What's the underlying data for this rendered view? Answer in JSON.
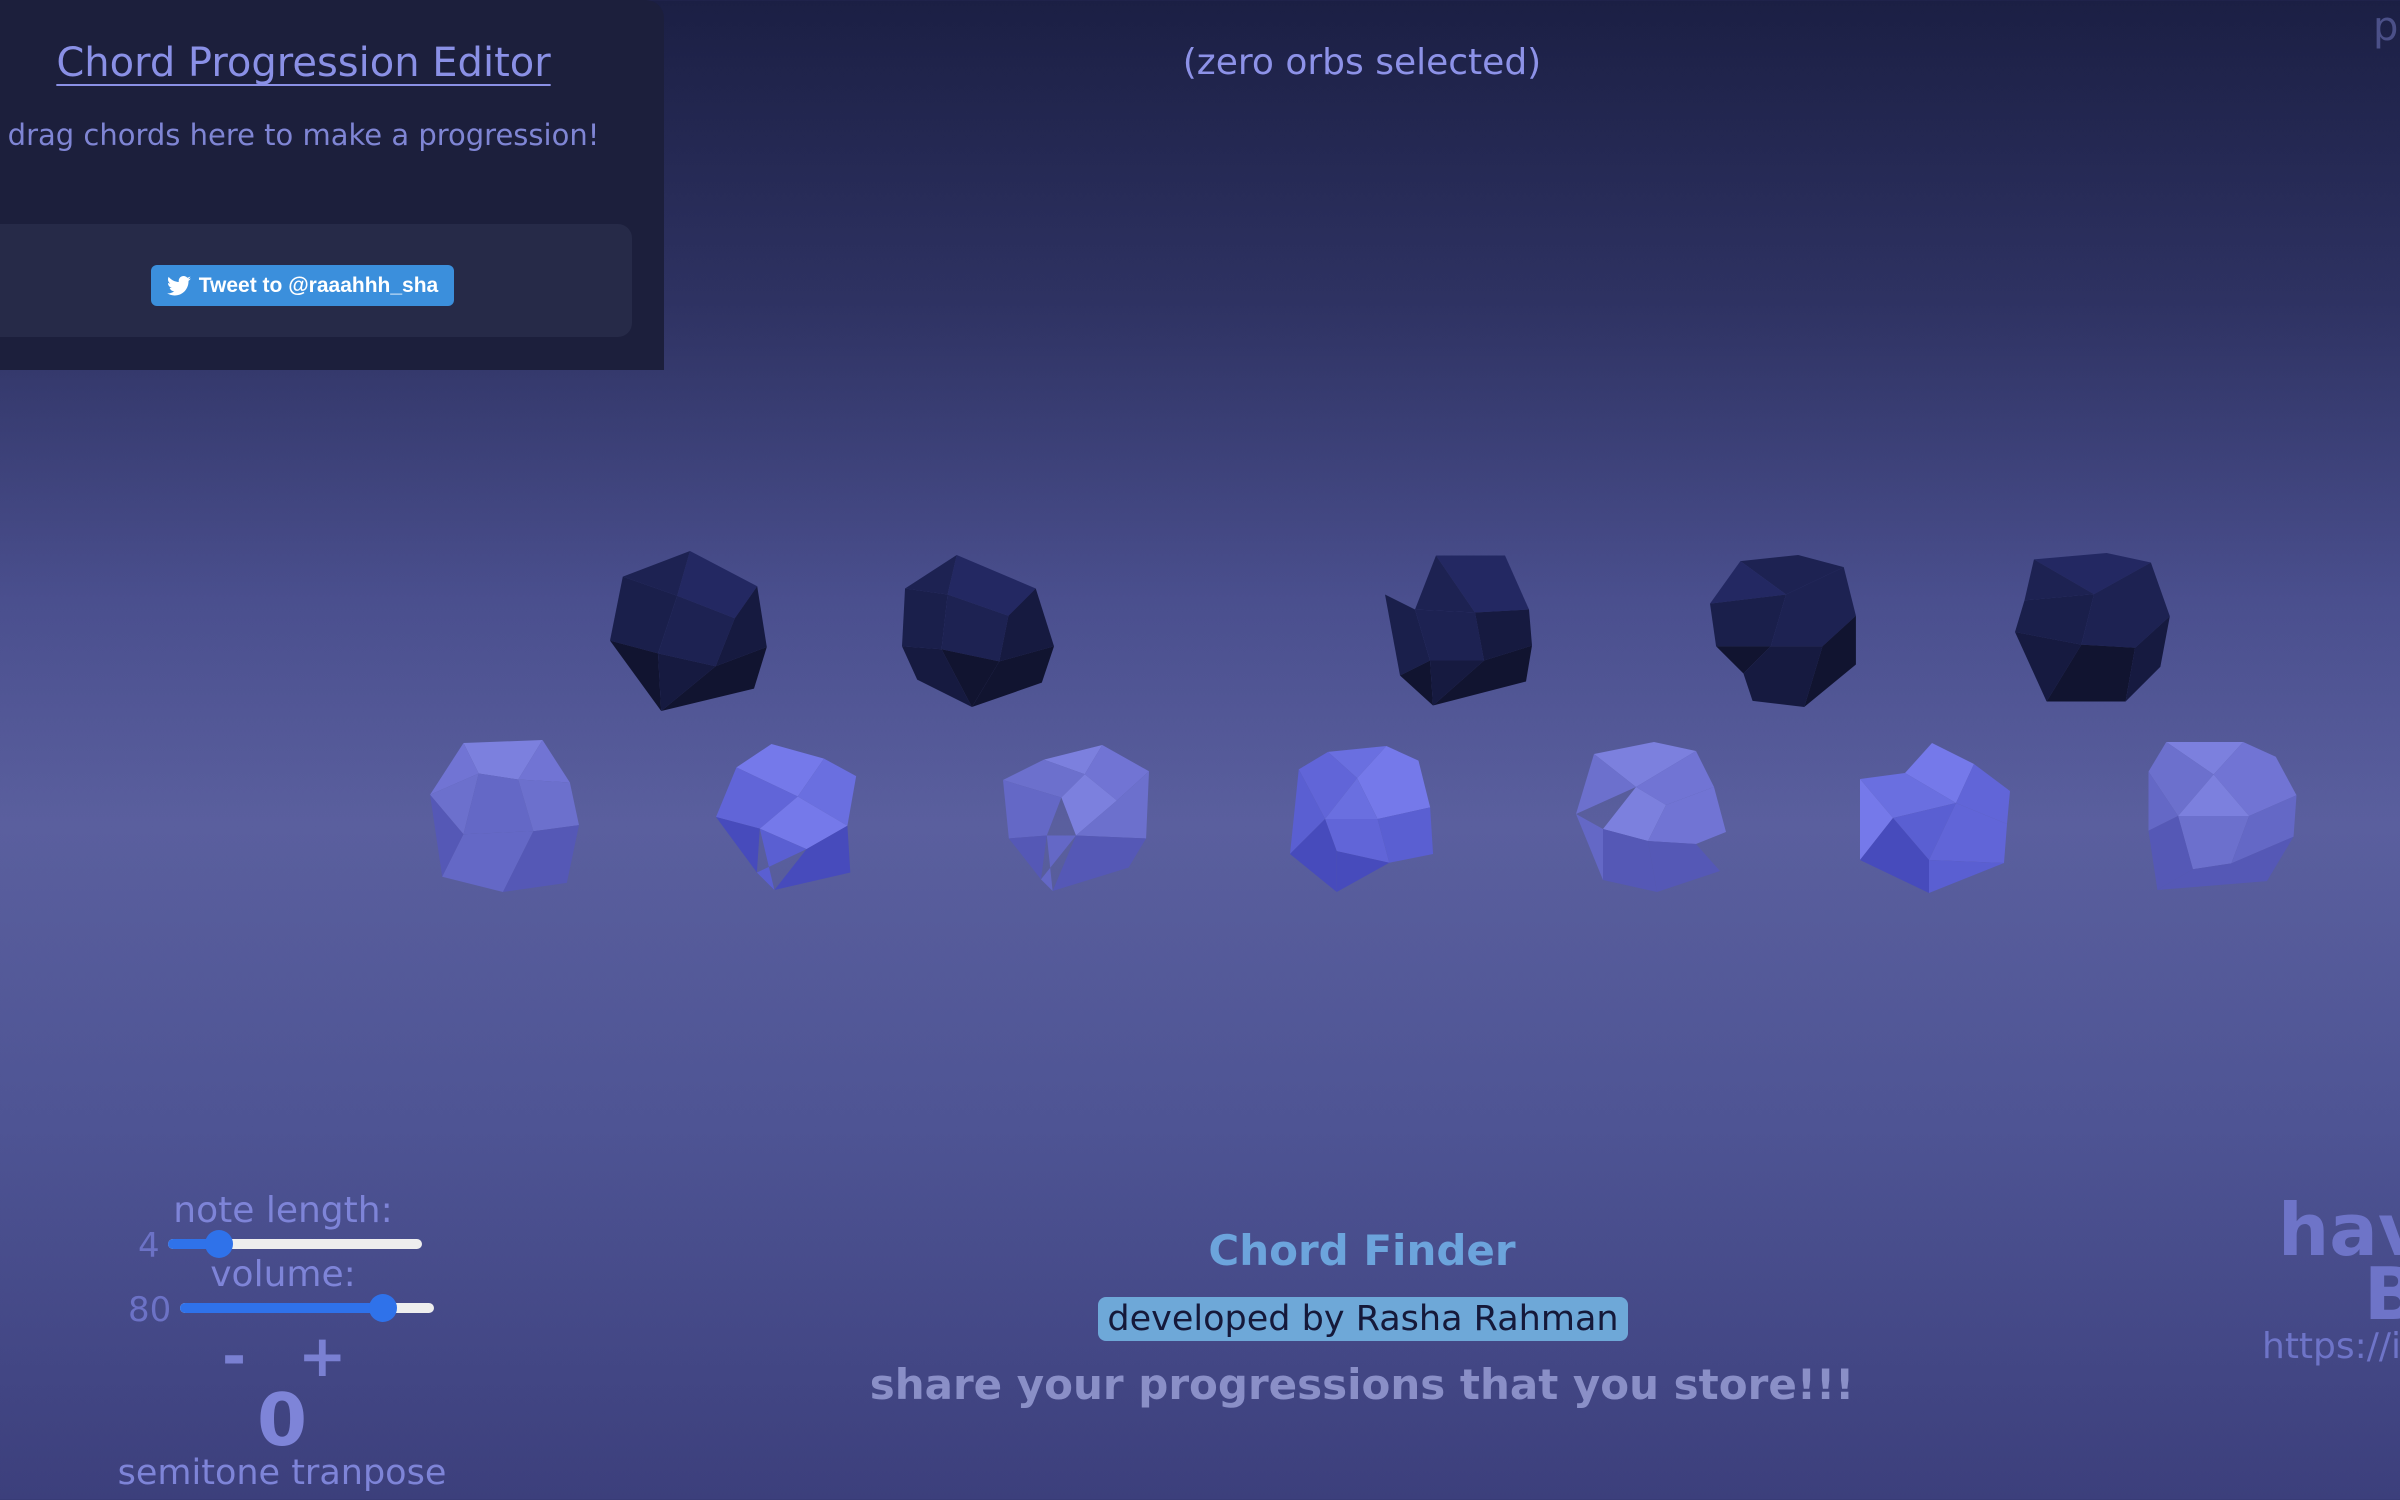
{
  "editor": {
    "title": "Chord Progression Editor",
    "hint": "drag chords here to make a progression!",
    "tweet_label": "Tweet to @raaahhh_sha"
  },
  "selection": {
    "status": "(zero orbs selected)"
  },
  "corner_text": "p",
  "orbs": {
    "top_row_count": 5,
    "bottom_row_count": 7
  },
  "controls": {
    "note_length_label": "note length:",
    "note_length_value": "4",
    "note_length_fraction": 0.2,
    "volume_label": "volume:",
    "volume_value": "80",
    "volume_fraction": 0.8,
    "minus_label": "-",
    "plus_label": "+",
    "transpose_value": "0",
    "transpose_label": "semitone tranpose"
  },
  "footer": {
    "title": "Chord Finder",
    "developer": "developed by Rasha Rahman",
    "share": "share your progressions that you store!!!"
  },
  "right_edge": {
    "line1": "hav",
    "line2": "B",
    "url": "https://i"
  },
  "colors": {
    "accent": "#8a90e6",
    "tweet_blue": "#3b8fdc",
    "slider_blue": "#2f72ea",
    "badge_blue": "#6ea8d8"
  }
}
